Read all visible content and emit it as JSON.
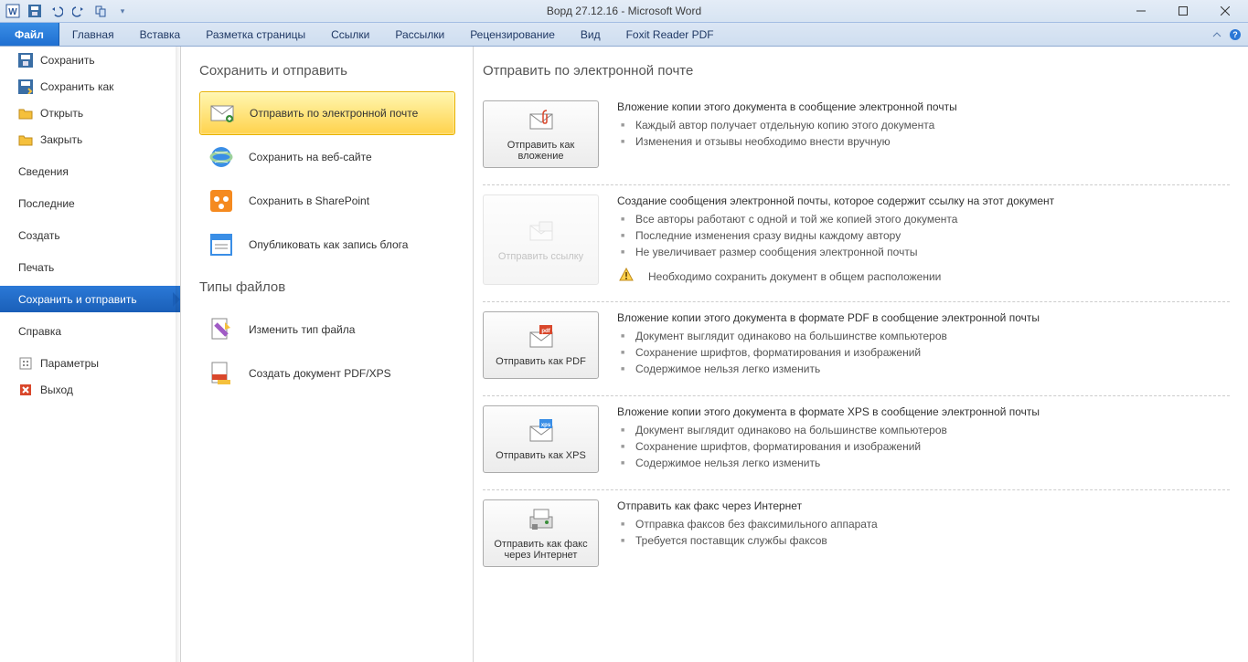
{
  "window": {
    "title": "Ворд 27.12.16 - Microsoft Word"
  },
  "ribbon": {
    "file": "Файл",
    "tabs": [
      "Главная",
      "Вставка",
      "Разметка страницы",
      "Ссылки",
      "Рассылки",
      "Рецензирование",
      "Вид",
      "Foxit Reader PDF"
    ]
  },
  "sidebar": {
    "items": [
      {
        "label": "Сохранить",
        "icon": "save"
      },
      {
        "label": "Сохранить как",
        "icon": "saveas"
      },
      {
        "label": "Открыть",
        "icon": "open"
      },
      {
        "label": "Закрыть",
        "icon": "close-doc"
      },
      {
        "label": "Сведения"
      },
      {
        "label": "Последние"
      },
      {
        "label": "Создать"
      },
      {
        "label": "Печать"
      },
      {
        "label": "Сохранить и отправить",
        "selected": true
      },
      {
        "label": "Справка"
      },
      {
        "label": "Параметры",
        "icon": "options"
      },
      {
        "label": "Выход",
        "icon": "exit"
      }
    ]
  },
  "mid": {
    "heading1": "Сохранить и отправить",
    "options1": [
      {
        "label": "Отправить по электронной почте",
        "icon": "mail",
        "selected": true
      },
      {
        "label": "Сохранить на веб-сайте",
        "icon": "globe"
      },
      {
        "label": "Сохранить в SharePoint",
        "icon": "sharepoint"
      },
      {
        "label": "Опубликовать как запись блога",
        "icon": "blog"
      }
    ],
    "heading2": "Типы файлов",
    "options2": [
      {
        "label": "Изменить тип файла",
        "icon": "changetype"
      },
      {
        "label": "Создать документ PDF/XPS",
        "icon": "pdfxps"
      }
    ]
  },
  "right": {
    "heading": "Отправить по электронной почте",
    "blocks": [
      {
        "button": {
          "label": "Отправить как вложение",
          "icon": "attach"
        },
        "title": "Вложение копии этого документа в сообщение электронной почты",
        "bullets": [
          "Каждый автор получает отдельную копию этого документа",
          "Изменения и отзывы необходимо внести вручную"
        ]
      },
      {
        "button": {
          "label": "Отправить ссылку",
          "icon": "link",
          "disabled": true
        },
        "title": "Создание сообщения электронной почты, которое содержит ссылку на этот документ",
        "bullets": [
          "Все авторы работают с одной и той же копией этого документа",
          "Последние изменения сразу видны каждому автору",
          "Не увеличивает размер сообщения электронной почты"
        ],
        "warning": "Необходимо сохранить документ в общем расположении"
      },
      {
        "button": {
          "label": "Отправить как PDF",
          "icon": "pdf"
        },
        "title": "Вложение копии этого документа в формате PDF в сообщение электронной почты",
        "bullets": [
          "Документ выглядит одинаково на большинстве компьютеров",
          "Сохранение шрифтов, форматирования и изображений",
          "Содержимое нельзя легко изменить"
        ]
      },
      {
        "button": {
          "label": "Отправить как XPS",
          "icon": "xps"
        },
        "title": "Вложение копии этого документа в формате XPS в сообщение электронной почты",
        "bullets": [
          "Документ выглядит одинаково на большинстве компьютеров",
          "Сохранение шрифтов, форматирования и изображений",
          "Содержимое нельзя легко изменить"
        ]
      },
      {
        "button": {
          "label": "Отправить как факс через Интернет",
          "icon": "fax"
        },
        "title": "Отправить как факс через Интернет",
        "bullets": [
          "Отправка факсов без факсимильного аппарата",
          "Требуется поставщик службы факсов"
        ]
      }
    ]
  }
}
